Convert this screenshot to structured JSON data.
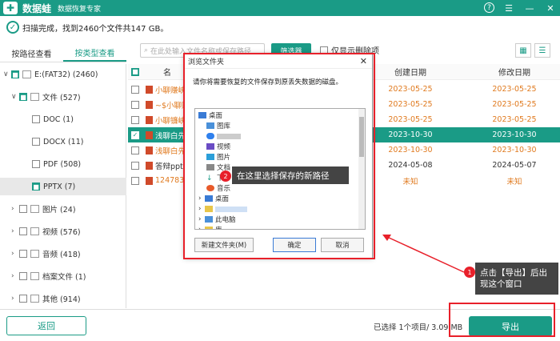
{
  "app": {
    "name": "数据蛙",
    "subtitle": "数据恢复专家"
  },
  "status": {
    "text": "扫描完成，找到2460个文件共147 GB。"
  },
  "left_tabs": [
    "按路径查看",
    "按类型查看"
  ],
  "search": {
    "placeholder": "在此处输入文件名称或保存路径"
  },
  "filter_label": "筛选器",
  "only_deleted_label": "仅显示删除项",
  "tree": [
    {
      "label": "E:(FAT32) (2460)"
    },
    {
      "label": "文件 (527)"
    },
    {
      "label": "DOC (1)"
    },
    {
      "label": "DOCX (11)"
    },
    {
      "label": "PDF (508)"
    },
    {
      "label": "PPTX (7)"
    },
    {
      "label": "图片 (24)"
    },
    {
      "label": "视频 (576)"
    },
    {
      "label": "音频 (418)"
    },
    {
      "label": "档案文件 (1)"
    },
    {
      "label": "其他 (914)"
    }
  ],
  "table": {
    "headers": {
      "name": "名",
      "created": "创建日期",
      "modified": "修改日期"
    },
    "rows": [
      {
        "name": "小聊赚峡",
        "created": "2023-05-25",
        "modified": "2023-05-25",
        "color": "orange"
      },
      {
        "name": "~$小聊赚",
        "created": "2023-05-25",
        "modified": "2023-05-25",
        "color": "orange"
      },
      {
        "name": "小聊镰峡",
        "created": "2023-05-25",
        "modified": "2023-05-25",
        "color": "orange"
      },
      {
        "name": "浅聊白先",
        "created": "2023-10-30",
        "modified": "2023-10-30",
        "color": "highlight"
      },
      {
        "name": "浅聊白先",
        "created": "2023-10-30",
        "modified": "2023-10-30",
        "color": "orange"
      },
      {
        "name": "答辩ppt.p",
        "created": "2024-05-08",
        "modified": "2024-05-07",
        "color": "normal"
      },
      {
        "name": "1247836.",
        "created": "未知",
        "modified": "未知",
        "color": "orange"
      }
    ]
  },
  "dialog": {
    "title": "浏览文件夹",
    "desc": "请你将需要恢复的文件保存到原丢失数据的磁盘。",
    "items": [
      "桌面",
      "图库",
      "",
      "视频",
      "图片",
      "文档",
      "下",
      "音乐",
      "桌面",
      "",
      "此电脑",
      "库"
    ],
    "new_folder": "新建文件夹(M)",
    "ok": "确定",
    "cancel": "取消"
  },
  "annotations": {
    "badge1": "1",
    "badge2": "2",
    "tip1": "点击【导出】后出现这个窗口",
    "tip2": "在这里选择保存的新路径"
  },
  "bottom": {
    "back": "返回",
    "selected": "已选择 1个项目/ 3.09 MB",
    "export": "导出"
  },
  "colors": {
    "accent": "#1a9b86",
    "orange": "#e07a1f",
    "annotation": "#e8202a"
  }
}
